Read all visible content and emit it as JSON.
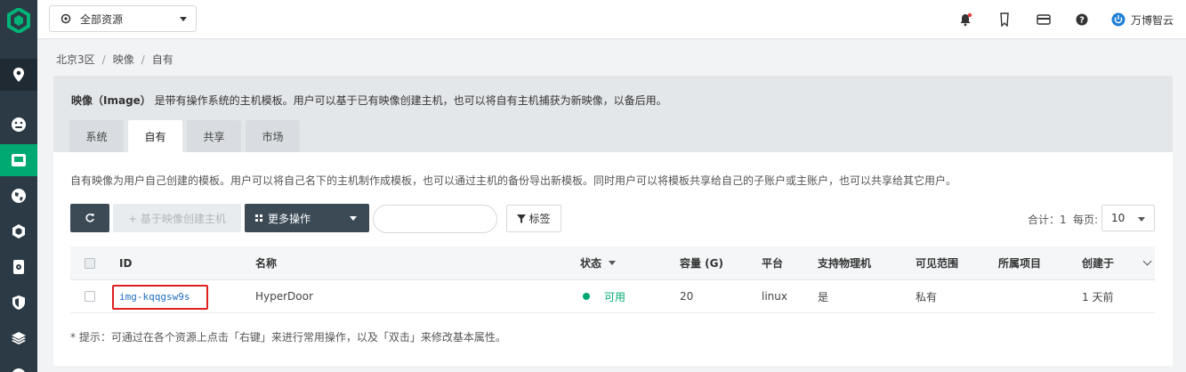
{
  "topbar": {
    "resource_select": "全部资源",
    "user_name": "万博智云"
  },
  "breadcrumb": {
    "items": [
      "北京3区",
      "映像",
      "自有"
    ]
  },
  "info": {
    "title": "映像（Image）",
    "text": "是带有操作系统的主机模板。用户可以基于已有映像创建主机，也可以将自有主机捕获为新映像，以备后用。"
  },
  "tabs": [
    {
      "label": "系统"
    },
    {
      "label": "自有"
    },
    {
      "label": "共享"
    },
    {
      "label": "市场"
    }
  ],
  "description": "自有映像为用户自己创建的模板。用户可以将自己名下的主机制作成模板，也可以通过主机的备份导出新模板。同时用户可以将模板共享给自己的子账户或主账户，也可以共享给其它用户。",
  "toolbar": {
    "create_label": "+ 基于映像创建主机",
    "more_label": "更多操作",
    "tag_label": "标签",
    "search_placeholder": "",
    "total_label": "合计：1",
    "page_size_label": "每页:",
    "page_size": "10"
  },
  "table": {
    "columns": {
      "id": "ID",
      "name": "名称",
      "status": "状态",
      "capacity": "容量 (G)",
      "platform": "平台",
      "physical": "支持物理机",
      "visibility": "可见范围",
      "project": "所属项目",
      "created": "创建于"
    },
    "rows": [
      {
        "id": "img-kqqgsw9s",
        "name": "HyperDoor",
        "status": "可用",
        "capacity": "20",
        "platform": "linux",
        "physical": "是",
        "visibility": "私有",
        "project": "",
        "created": "1 天前"
      }
    ]
  },
  "hint": "* 提示：可通过在各个资源上点击「右键」来进行常用操作，以及「双击」来修改基本属性。",
  "colors": {
    "sidebar": "#2b3a45",
    "accent_green": "#00a971",
    "dark_button": "#3c4a56",
    "link_blue": "#1e6fc1",
    "highlight_red": "#e02020"
  }
}
